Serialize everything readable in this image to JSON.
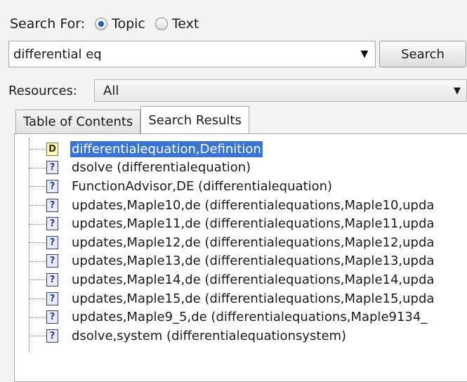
{
  "search_for": {
    "label": "Search For:",
    "options": [
      {
        "label": "Topic",
        "checked": true
      },
      {
        "label": "Text",
        "checked": false
      }
    ]
  },
  "query": {
    "value": "differential eq"
  },
  "search_button": {
    "label": "Search"
  },
  "resources": {
    "label": "Resources:",
    "selected": "All"
  },
  "tabs": [
    {
      "label": "Table of Contents",
      "active": false
    },
    {
      "label": "Search Results",
      "active": true
    }
  ],
  "results": [
    {
      "label": "differentialequation,Definition",
      "icon": "D",
      "icon_name": "definition-icon",
      "selected": true
    },
    {
      "label": "dsolve (differentialequation)",
      "icon": "?",
      "icon_name": "help-page-icon",
      "selected": false
    },
    {
      "label": "FunctionAdvisor,DE (differentialequation)",
      "icon": "?",
      "icon_name": "help-page-icon",
      "selected": false
    },
    {
      "label": "updates,Maple10,de (differentialequations,Maple10,upda",
      "icon": "?",
      "icon_name": "help-page-icon",
      "selected": false
    },
    {
      "label": "updates,Maple11,de (differentialequations,Maple11,upda",
      "icon": "?",
      "icon_name": "help-page-icon",
      "selected": false
    },
    {
      "label": "updates,Maple12,de (differentialequations,Maple12,upda",
      "icon": "?",
      "icon_name": "help-page-icon",
      "selected": false
    },
    {
      "label": "updates,Maple13,de (differentialequations,Maple13,upda",
      "icon": "?",
      "icon_name": "help-page-icon",
      "selected": false
    },
    {
      "label": "updates,Maple14,de (differentialequations,Maple14,upda",
      "icon": "?",
      "icon_name": "help-page-icon",
      "selected": false
    },
    {
      "label": "updates,Maple15,de (differentialequations,Maple15,upda",
      "icon": "?",
      "icon_name": "help-page-icon",
      "selected": false
    },
    {
      "label": "updates,Maple9_5,de (differentialequations,Maple9134_",
      "icon": "?",
      "icon_name": "help-page-icon",
      "selected": false
    },
    {
      "label": "dsolve,system (differentialequationsystem)",
      "icon": "?",
      "icon_name": "help-page-icon",
      "selected": false
    }
  ],
  "colors": {
    "selection": "#3875d7",
    "icon_border": "#2f3c8c"
  }
}
